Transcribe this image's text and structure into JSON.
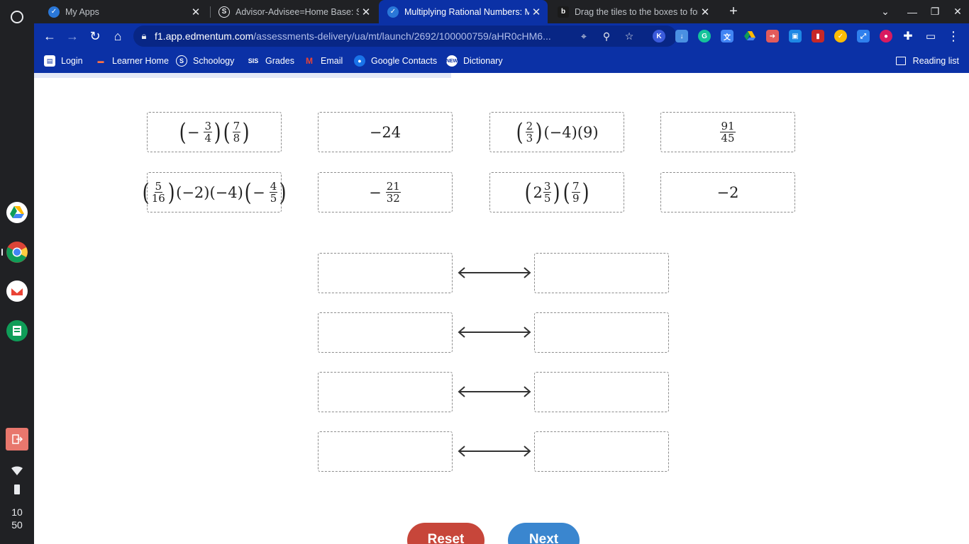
{
  "tabs": [
    {
      "title": "My Apps",
      "favicon": "edmentum-icon"
    },
    {
      "title": "Advisor-Advisee=Home Base: Se",
      "favicon": "schoology-icon"
    },
    {
      "title": "Multiplying Rational Numbers: M",
      "favicon": "edmentum-icon"
    },
    {
      "title": "Drag the tiles to the boxes to for",
      "favicon": "brainly-icon"
    }
  ],
  "address_bar": {
    "host": "f1.app.edmentum.com",
    "path": "/assessments-delivery/ua/mt/launch/2692/100000759/aHR0cHM6..."
  },
  "bookmarks": [
    "Login",
    "Learner Home",
    "Schoology",
    "Grades",
    "Email",
    "Google Contacts",
    "Dictionary"
  ],
  "bookmark_grades_badge": "SIS",
  "reading_list": "Reading list",
  "tiles": [
    {
      "parts": [
        {
          "t": "p",
          "v": "("
        },
        {
          "t": "s",
          "v": "−"
        },
        {
          "t": "f",
          "n": "3",
          "d": "4"
        },
        {
          "t": "p",
          "v": ")"
        },
        {
          "t": "p",
          "v": "("
        },
        {
          "t": "f",
          "n": "7",
          "d": "8"
        },
        {
          "t": "p",
          "v": ")"
        }
      ]
    },
    {
      "parts": [
        {
          "t": "s",
          "v": "−24"
        }
      ]
    },
    {
      "parts": [
        {
          "t": "p",
          "v": "("
        },
        {
          "t": "f",
          "n": "2",
          "d": "3"
        },
        {
          "t": "p",
          "v": ")"
        },
        {
          "t": "s",
          "v": "(−4)(9)"
        }
      ]
    },
    {
      "parts": [
        {
          "t": "f",
          "n": "91",
          "d": "45"
        }
      ]
    },
    {
      "parts": [
        {
          "t": "p",
          "v": "("
        },
        {
          "t": "f",
          "n": "5",
          "d": "16"
        },
        {
          "t": "p",
          "v": ")"
        },
        {
          "t": "s",
          "v": "(−2)(−4)"
        },
        {
          "t": "p",
          "v": "("
        },
        {
          "t": "s",
          "v": "−"
        },
        {
          "t": "f",
          "n": "4",
          "d": "5"
        },
        {
          "t": "p",
          "v": ")"
        }
      ]
    },
    {
      "parts": [
        {
          "t": "s",
          "v": "−"
        },
        {
          "t": "f",
          "n": "21",
          "d": "32"
        }
      ]
    },
    {
      "parts": [
        {
          "t": "p",
          "v": "("
        },
        {
          "t": "s",
          "v": "2"
        },
        {
          "t": "f",
          "n": "3",
          "d": "5"
        },
        {
          "t": "p",
          "v": ")"
        },
        {
          "t": "p",
          "v": "("
        },
        {
          "t": "f",
          "n": "7",
          "d": "9"
        },
        {
          "t": "p",
          "v": ")"
        }
      ]
    },
    {
      "parts": [
        {
          "t": "s",
          "v": "−2"
        }
      ]
    }
  ],
  "pairs_count_rows": 4,
  "buttons": {
    "reset": "Reset",
    "next": "Next"
  },
  "shelf": {
    "clock_hour": "10",
    "clock_min": "50"
  },
  "colors": {
    "browser_theme": "#0b31a6",
    "reset": "#c7463a",
    "next": "#3a86cf"
  }
}
